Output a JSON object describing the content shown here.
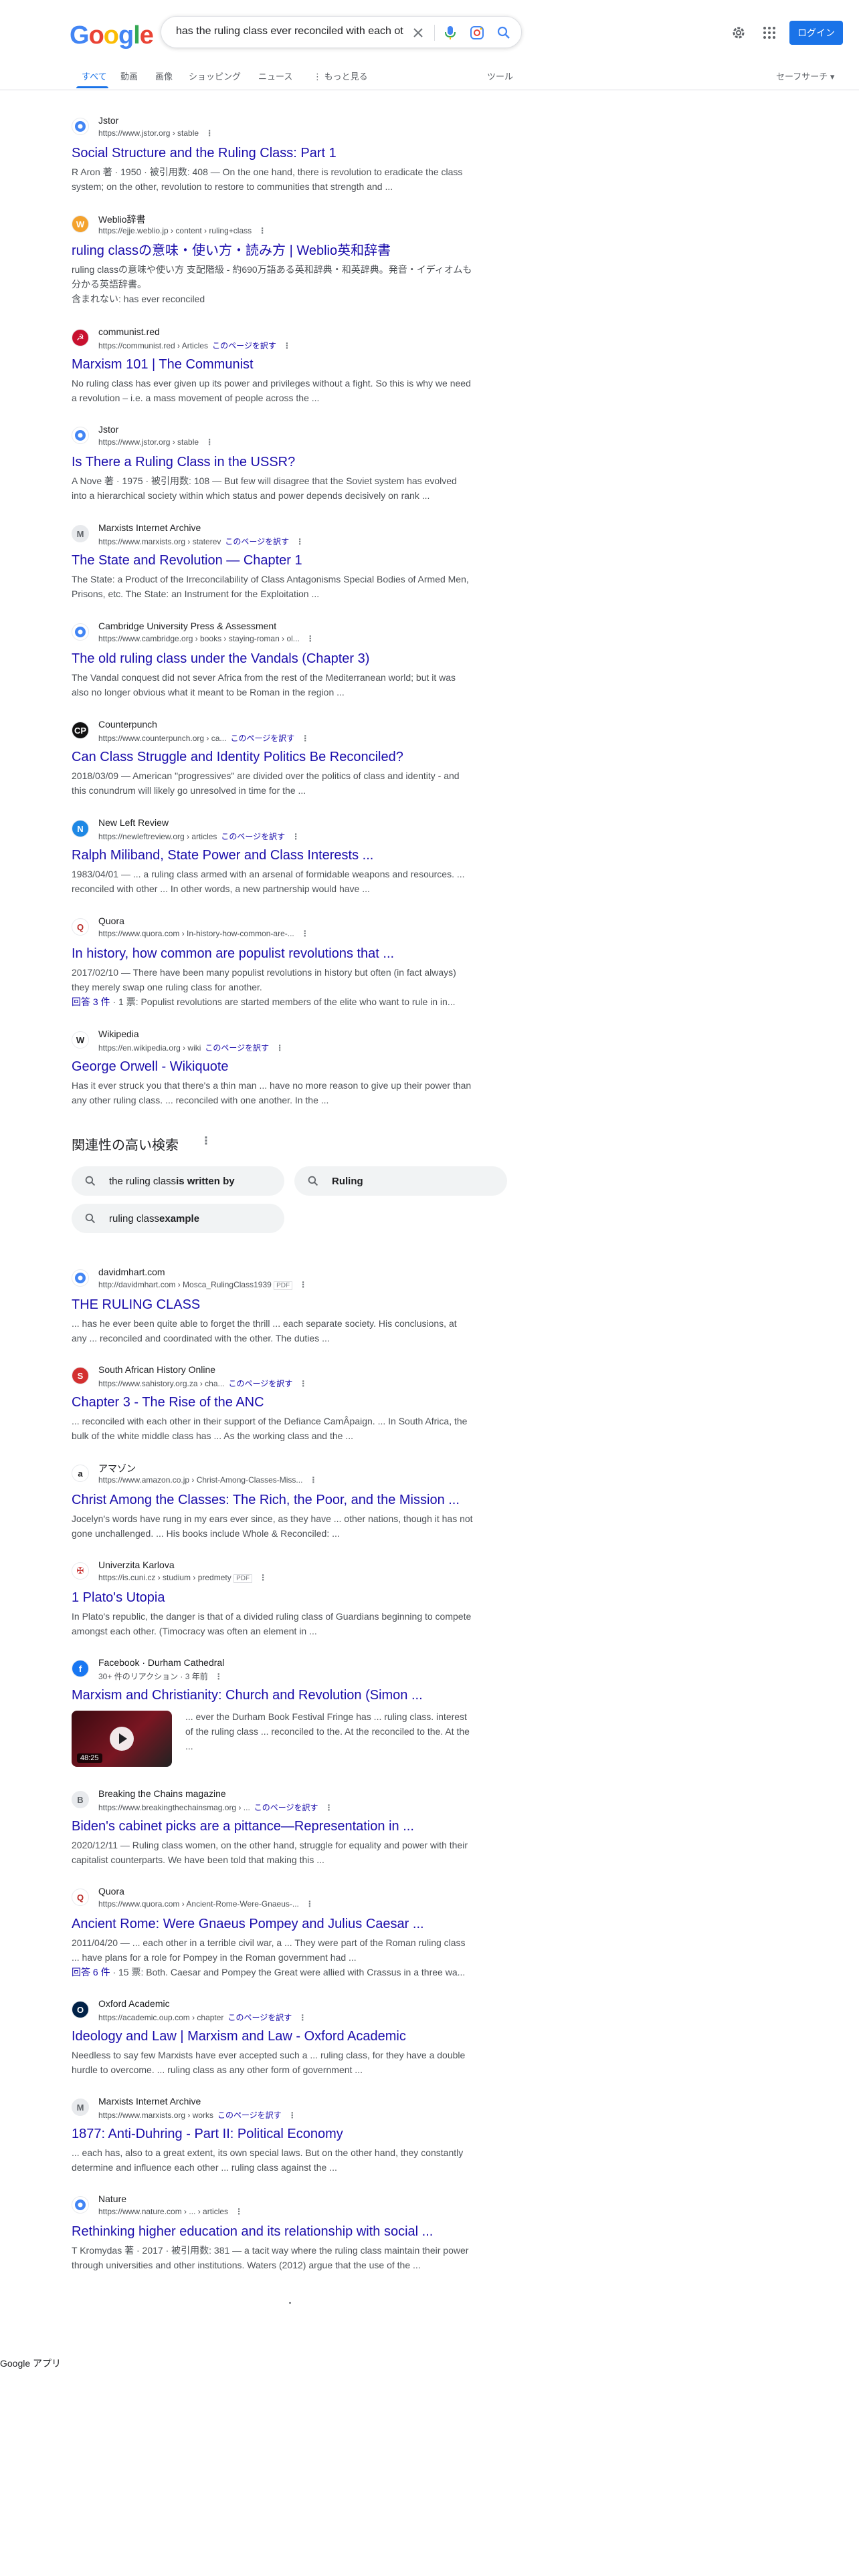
{
  "header": {
    "logo": {
      "l1": "G",
      "l2": "o",
      "l3": "o",
      "l4": "g",
      "l5": "l",
      "l6": "e"
    },
    "query": "has the ruling class ever reconciled with each other",
    "login_label": "ログイン"
  },
  "tabs": {
    "all": "すべて",
    "videos": "動画",
    "images": "画像",
    "shopping": "ショッピング",
    "news": "ニュース",
    "more": "⋮ もっと見る",
    "tools": "ツール",
    "safesearch": "セーフサーチ ▾"
  },
  "translate_label": "このページを訳す",
  "results": [
    {
      "site": "Jstor",
      "url": "https://www.jstor.org › stable",
      "title": "Social Structure and the Ruling Class: Part 1",
      "snippet": "R Aron 著 · 1950 · 被引用数: 408 — On the one hand, there is revolution to eradicate the class system; on the other, revolution to restore to communities that strength and ..."
    },
    {
      "site": "Weblio辞書",
      "url": "https://ejje.weblio.jp › content › ruling+class",
      "title": "ruling classの意味・使い方・読み方 | Weblio英和辞書",
      "snippet": "ruling classの意味や使い方 支配階級 - 約690万語ある英和辞典・和英辞典。発音・イディオムも分かる英語辞書。",
      "extra": "含まれない: has  ever  reconciled"
    },
    {
      "site": "communist.red",
      "url": "https://communist.red › Articles",
      "title": "Marxism 101 | The Communist",
      "snippet": "No ruling class has ever given up its power and privileges without a fight. So this is why we need a revolution – i.e. a mass movement of people across the ..."
    },
    {
      "site": "Jstor",
      "url": "https://www.jstor.org › stable",
      "title": "Is There a Ruling Class in the USSR?",
      "snippet": "A Nove 著 · 1975 · 被引用数: 108 — But few will disagree that the Soviet system has evolved into a hierarchical society within which status and power depends decisively on rank ..."
    },
    {
      "site": "Marxists Internet Archive",
      "url": "https://www.marxists.org › staterev",
      "title": "The State and Revolution — Chapter 1",
      "snippet": "The State: a Product of the Irreconcilability of Class Antagonisms Special Bodies of Armed Men, Prisons, etc. The State: an Instrument for the Exploitation ..."
    },
    {
      "site": "Cambridge University Press & Assessment",
      "url": "https://www.cambridge.org › books › staying-roman › ol...",
      "title": "The old ruling class under the Vandals (Chapter 3)",
      "snippet": "The Vandal conquest did not sever Africa from the rest of the Mediterranean world; but it was also no longer obvious what it meant to be Roman in the region ..."
    },
    {
      "site": "Counterpunch",
      "url": "https://www.counterpunch.org › ca...",
      "title": "Can Class Struggle and Identity Politics Be Reconciled?",
      "snippet": "2018/03/09 — American \"progressives\" are divided over the politics of class and identity - and this conundrum will likely go unresolved in time for the ..."
    },
    {
      "site": "New Left Review",
      "url": "https://newleftreview.org › articles",
      "title": "Ralph Miliband, State Power and Class Interests ...",
      "snippet": "1983/04/01 — ... a ruling class armed with an arsenal of formidable weapons and resources. ... reconciled with other ... In other words, a new partnership would have ..."
    },
    {
      "site": "Quora",
      "url": "https://www.quora.com › In-history-how-common-are-...",
      "title": "In history, how common are populist revolutions that ...",
      "snippet": "2017/02/10 — There have been many populist revolutions in history but often (in fact always) they merely swap one ruling class for another.",
      "extra_link": "回答 3 件",
      "extra": " · 1 票: Populist revolutions are started members of the elite who want to rule in in..."
    },
    {
      "site": "Wikipedia",
      "url": "https://en.wikipedia.org › wiki",
      "title": "George Orwell - Wikiquote",
      "snippet": "Has it ever struck you that there's a thin man ... have no more reason to give up their power than any other ruling class. ... reconciled with one another. In the ..."
    }
  ],
  "related": {
    "title": "関連性の高い検索",
    "chips": [
      {
        "plain": "the ruling class ",
        "bold": "is written by"
      },
      {
        "plain": "",
        "bold": "Ruling"
      },
      {
        "plain": "ruling class ",
        "bold": "example"
      }
    ]
  },
  "results2": [
    {
      "site": "davidmhart.com",
      "url": "http://davidmhart.com › Mosca_RulingClass1939",
      "badge": "PDF",
      "title": "THE RULING CLASS",
      "snippet": "... has he ever been quite able to forget the thrill ... each separate society. His conclusions, at any ... reconciled and coordinated with the other. The duties ..."
    },
    {
      "site": "South African History Online",
      "url": "https://www.sahistory.org.za › cha...",
      "title": "Chapter 3 - The Rise of the ANC",
      "snippet": "... reconciled with each other in their support of the Defiance CamÂpaign. ... In South Africa, the bulk of the white middle class has ... As the working class and the ..."
    },
    {
      "site": "アマゾン",
      "url": "https://www.amazon.co.jp › Christ-Among-Classes-Miss...",
      "title": "Christ Among the Classes: The Rich, the Poor, and the Mission ...",
      "snippet": "Jocelyn's words have rung in my ears ever since, as they have ... other nations, though it has not gone unchallenged. ... His books include Whole & Reconciled: ..."
    },
    {
      "site": "Univerzita Karlova",
      "url": "https://is.cuni.cz › studium › predmety",
      "badge": "PDF",
      "title": "1 Plato's Utopia",
      "snippet": "In Plato's republic, the danger is that of a divided ruling class of Guardians beginning to compete amongst each other. (Timocracy was often an element in ..."
    },
    {
      "site": "Facebook · Durham Cathedral",
      "url": "30+ 件のリアクション · 3 年前",
      "title": "Marxism and Christianity: Church and Revolution (Simon ...",
      "video_snippet": "... ever the Durham Book Festival Fringe has ... ruling class. interest of the ruling class ... reconciled to the. At the reconciled to the. At the ...",
      "video_duration": "48:25"
    },
    {
      "site": "Breaking the Chains magazine",
      "url": "https://www.breakingthechainsmag.org › ...",
      "title": "Biden's cabinet picks are a pittance—Representation in ...",
      "snippet": "2020/12/11 — Ruling class women, on the other hand, struggle for equality and power with their capitalist counterparts. We have been told that making this ..."
    },
    {
      "site": "Quora",
      "url": "https://www.quora.com › Ancient-Rome-Were-Gnaeus-...",
      "title": "Ancient Rome: Were Gnaeus Pompey and Julius Caesar ...",
      "snippet": "2011/04/20 — ... each other in a terrible civil war, a ... They were part of the Roman ruling class ... have plans for a role for Pompey in the Roman government had ...",
      "extra_link": "回答 6 件",
      "extra": " · 15 票: Both. Caesar and Pompey the Great were allied with Crassus in a three wa..."
    },
    {
      "site": "Oxford Academic",
      "url": "https://academic.oup.com › chapter",
      "title": "Ideology and Law | Marxism and Law - Oxford Academic",
      "snippet": "Needless to say few Marxists have ever accepted such a ... ruling class, for they have a double hurdle to overcome. ... ruling class as any other form of government ..."
    },
    {
      "site": "Marxists Internet Archive",
      "url": "https://www.marxists.org › works",
      "title": "1877: Anti-Duhring - Part II: Political Economy",
      "snippet": "... each has, also to a great extent, its own special laws. But on the other hand, they constantly determine and influence each other ... ruling class against the ..."
    },
    {
      "site": "Nature",
      "url": "https://www.nature.com › ... › articles",
      "title": "Rethinking higher education and its relationship with social ...",
      "snippet": "T Kromydas 著 · 2017 · 被引用数: 381 — a tacit way where the ruling class maintain their power through universities and other institutions. Waters (2012) argue that the use of the ..."
    }
  ],
  "footer": {
    "apps": "Google アプリ"
  },
  "colors": {
    "link": "#1a0dab",
    "accent": "#1a73e8",
    "text": "#202124",
    "secondary": "#4d5156"
  }
}
